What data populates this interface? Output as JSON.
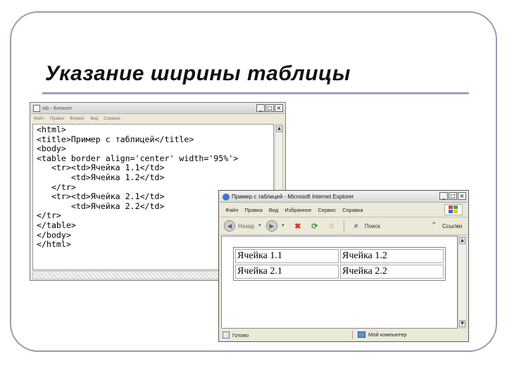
{
  "slide": {
    "title": "Указание ширины таблицы"
  },
  "notepad": {
    "title": "tab - Блокнот",
    "menu": [
      "Файл",
      "Правка",
      "Формат",
      "Вид",
      "Справка"
    ],
    "code_lines": [
      "<html>",
      "<title>Пример с таблицей</title>",
      "<body>",
      "<table border align='center' width='95%'>",
      "   <tr><td>Ячейка 1.1</td>",
      "       <td>Ячейка 1.2</td>",
      "   </tr>",
      "   <tr><td>Ячейка 2.1</td>",
      "       <td>Ячейка 2.2</td>",
      "</tr>",
      "</table>",
      "</body>",
      "</html>"
    ],
    "buttons": {
      "minimize": "_",
      "maximize": "□",
      "close": "×"
    }
  },
  "ie": {
    "title": "Пример с таблицей - Microsoft Internet Explorer",
    "menu": [
      "Файл",
      "Правка",
      "Вид",
      "Избранное",
      "Сервис",
      "Справка"
    ],
    "toolbar": {
      "back": "Назад",
      "search": "Поиск",
      "chevron": "»",
      "links": "Ссылки"
    },
    "table": [
      [
        "Ячейка 1.1",
        "Ячейка 1.2"
      ],
      [
        "Ячейка 2.1",
        "Ячейка 2.2"
      ]
    ],
    "status": {
      "left": "Готово",
      "right": "Мой компьютер"
    },
    "buttons": {
      "minimize": "_",
      "maximize": "□",
      "close": "×"
    }
  }
}
